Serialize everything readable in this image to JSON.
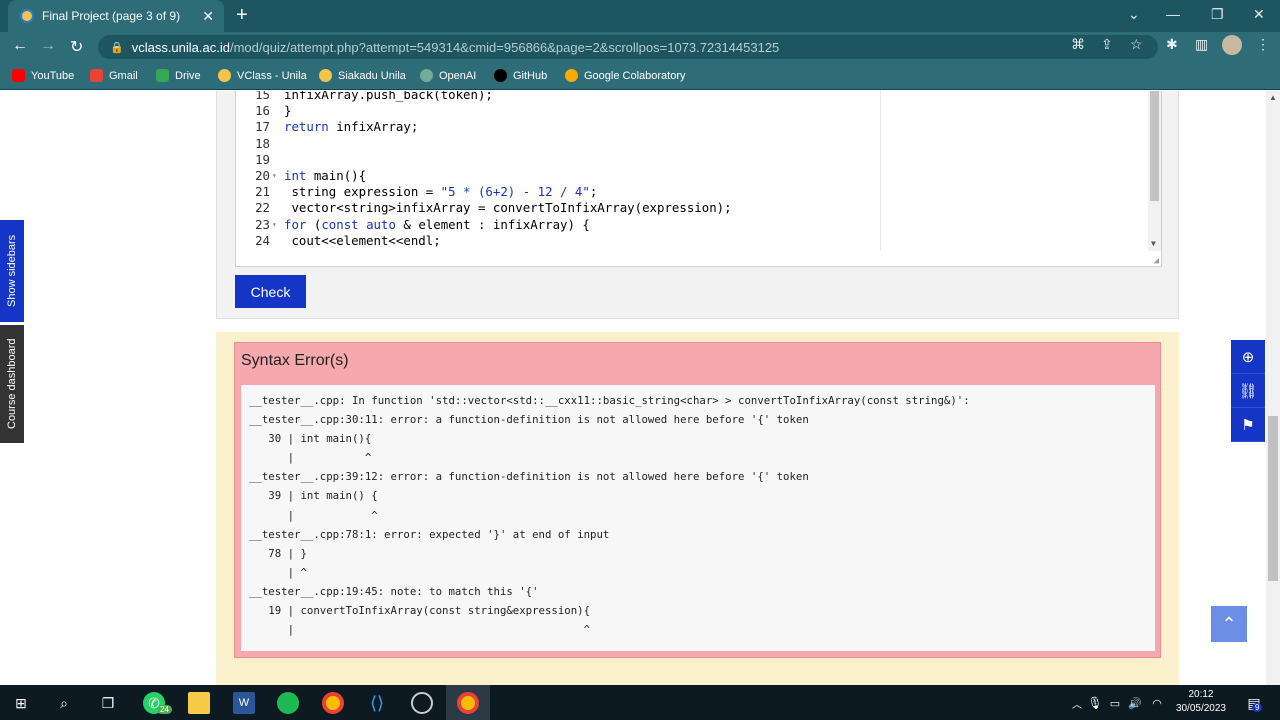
{
  "browser": {
    "tab_title": "Final Project (page 3 of 9)",
    "url_host": "vclass.unila.ac.id",
    "url_path": "/mod/quiz/attempt.php?attempt=549314&cmid=956866&page=2&scrollpos=1073.72314453125"
  },
  "bookmarks": [
    {
      "label": "YouTube",
      "color": "#ff0000"
    },
    {
      "label": "Gmail",
      "color": "#ea4335"
    },
    {
      "label": "Drive",
      "color": "#34a853"
    },
    {
      "label": "VClass - Unila",
      "color": "#f3c44b"
    },
    {
      "label": "Siakadu Unila",
      "color": "#f3c44b"
    },
    {
      "label": "OpenAI",
      "color": "#74aa9c"
    },
    {
      "label": "GitHub",
      "color": "#000000"
    },
    {
      "label": "Google Colaboratory",
      "color": "#f9ab00"
    }
  ],
  "side_tabs": {
    "show_sidebars": "Show sidebars",
    "course_dashboard": "Course dashboard"
  },
  "editor": {
    "lines": [
      {
        "n": "15",
        "fold": "",
        "text": "infixArray.push_back(token);"
      },
      {
        "n": "16",
        "fold": "",
        "text": "}"
      },
      {
        "n": "17",
        "fold": "",
        "text": "return infixArray;"
      },
      {
        "n": "18",
        "fold": "",
        "text": ""
      },
      {
        "n": "19",
        "fold": "",
        "text": ""
      },
      {
        "n": "20",
        "fold": "▾",
        "text": "int main(){"
      },
      {
        "n": "21",
        "fold": "",
        "text": " string expression = \"5 * (6+2) - 12 / 4\";"
      },
      {
        "n": "22",
        "fold": "",
        "text": " vector<string>infixArray = convertToInfixArray(expression);"
      },
      {
        "n": "23",
        "fold": "▾",
        "text": "for (const auto & element : infixArray) {"
      },
      {
        "n": "24",
        "fold": "",
        "text": " cout<<element<<endl;"
      }
    ]
  },
  "check_button": "Check",
  "error": {
    "title": "Syntax Error(s)",
    "lines": [
      "__tester__.cpp: In function 'std::vector<std::__cxx11::basic_string<char> > convertToInfixArray(const string&)':",
      "__tester__.cpp:30:11: error: a function-definition is not allowed here before '{' token",
      "   30 | int main(){",
      "      |           ^",
      "__tester__.cpp:39:12: error: a function-definition is not allowed here before '{' token",
      "   39 | int main() {",
      "      |            ^",
      "__tester__.cpp:78:1: error: expected '}' at end of input",
      "   78 | }",
      "      | ^",
      "__tester__.cpp:19:45: note: to match this '{'",
      "   19 | convertToInfixArray(const string&expression){",
      "      |                                             ^"
    ]
  },
  "float_icons": [
    "lifebuoy-icon",
    "link-icon",
    "flag-icon"
  ],
  "taskbar": {
    "time": "20:12",
    "date": "30/05/2023",
    "whatsapp_badge": "24",
    "notification_badge": "9"
  }
}
